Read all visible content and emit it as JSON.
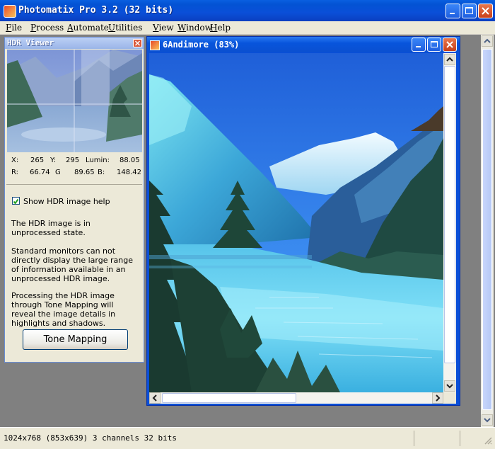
{
  "app": {
    "title": "Photomatix Pro 3.2 (32 bits)"
  },
  "menu": [
    "File",
    "Process",
    "Automate",
    "Utilities",
    "View",
    "Window",
    "Help"
  ],
  "hdr_viewer": {
    "title": "HDR Viewer",
    "x_label": "X:",
    "x_value": "265",
    "y_label": "Y:",
    "y_value": "295",
    "lumin_label": "Lumin:",
    "lumin_value": "88.05",
    "r_label": "R:",
    "r_value": "66.74",
    "g_label": "G",
    "g_value": "89.65",
    "b_label": "B:",
    "b_value": "148.42",
    "show_help_label": "Show HDR image help",
    "show_help_checked": true,
    "help_para1": "The HDR image is in unprocessed state.",
    "help_para2": "Standard monitors can not directly display the large range of information available in an unprocessed HDR image.",
    "help_para3": "Processing the HDR image through Tone Mapping will reveal the image details in highlights and shadows.",
    "tone_button": "Tone Mapping"
  },
  "image_window": {
    "title": "6Andimore (83%)"
  },
  "status": {
    "text": "1024x768 (853x639) 3 channels 32 bits"
  },
  "colors": {
    "titlebar": "#0353d4",
    "menubar": "#ece9d8",
    "mdi_background": "#808080",
    "close_button": "#c9401a"
  }
}
